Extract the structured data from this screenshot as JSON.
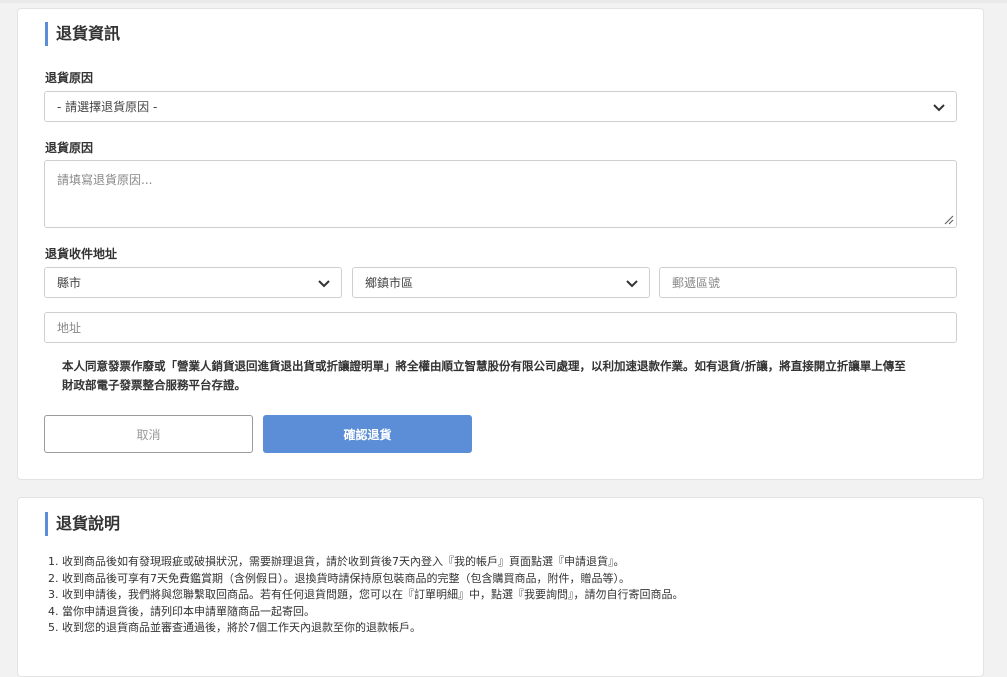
{
  "return_info": {
    "title": "退貨資訊",
    "reason_select_label": "退貨原因",
    "reason_select_value": "- 請選擇退貨原因 -",
    "reason_text_label": "退貨原因",
    "reason_text_placeholder": "請填寫退貨原因...",
    "address_label": "退貨收件地址",
    "county_select_value": "縣市",
    "district_select_value": "鄉鎮市區",
    "postal_placeholder": "郵遞區號",
    "address_placeholder": "地址",
    "consent_text_line1": "本人同意發票作廢或「營業人銷貨退回進貨退出貨或折讓證明單」將全權由順立智慧股份有限公司處理，以利加速退款作業。如有退貨/折讓，將直接開立折讓單上傳至",
    "consent_text_line2": "財政部電子發票整合服務平台存證。",
    "cancel_label": "取消",
    "confirm_label": "確認退貨"
  },
  "return_notes": {
    "title": "退貨說明",
    "items": [
      "1. 收到商品後如有發現瑕疵或破損狀況，需要辦理退貨，請於收到貨後7天內登入『我的帳戶』頁面點選『申請退貨』。",
      "2. 收到商品後可享有7天免費鑑賞期（含例假日）。退換貨時請保持原包裝商品的完整（包含購買商品，附件，贈品等）。",
      "3. 收到申請後，我們將與您聯繫取回商品。若有任何退貨問題，您可以在『訂單明細』中，點選『我要詢問』，請勿自行寄回商品。",
      "4. 當你申請退貨後，請列印本申請單隨商品一起寄回。",
      "5. 收到您的退貨商品並審查通過後，將於7個工作天內退款至你的退款帳戶。"
    ]
  },
  "colors": {
    "accent": "#5b8ed6",
    "page_bg": "#f2f2f2"
  },
  "icons": {
    "select_arrow": "chevron-down-icon",
    "textarea_resize": "resize-handle-icon"
  }
}
